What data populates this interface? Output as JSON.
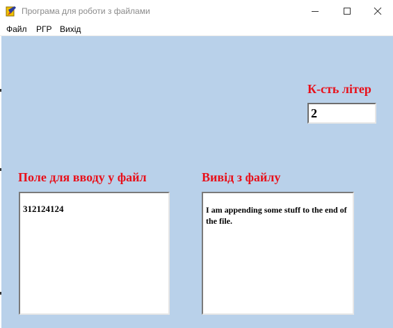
{
  "window": {
    "title": "Програма для роботи з файлами",
    "icon": "delphi-app-icon",
    "controls": {
      "minimize": "minimize-icon",
      "maximize": "maximize-icon",
      "close": "close-icon"
    }
  },
  "menu": {
    "items": [
      {
        "label": "Файл"
      },
      {
        "label": "РГР"
      },
      {
        "label": "Вихід"
      }
    ]
  },
  "form": {
    "count_label": "К-сть літер",
    "count_value": "2",
    "input_label": "Поле для вводу у файл",
    "input_text": "312124124",
    "output_label": "Вивід з файлу",
    "output_text": "I am appending some stuff to the end of the file."
  },
  "colors": {
    "client_background": "#b9d1ea",
    "label_red": "#e8101a"
  }
}
